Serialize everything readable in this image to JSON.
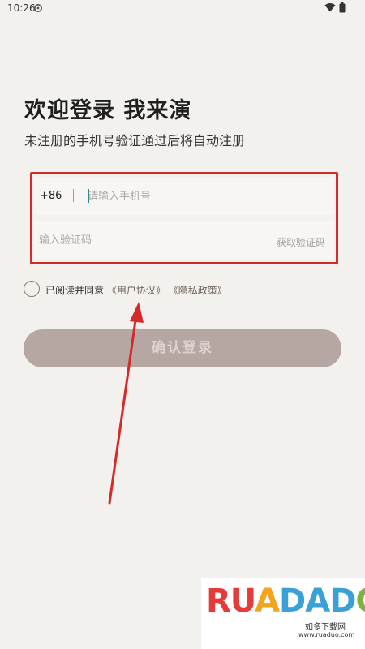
{
  "status_bar": {
    "time": "10:26",
    "icons": [
      "settings-icon",
      "wifi-icon",
      "battery-icon"
    ]
  },
  "header": {
    "title": "欢迎登录 我来演",
    "subtitle": "未注册的手机号验证通过后将自动注册"
  },
  "phone": {
    "country_code": "+86",
    "placeholder": "请输入手机号",
    "value": ""
  },
  "verification": {
    "placeholder": "输入验证码",
    "value": "",
    "get_code_label": "获取验证码"
  },
  "agreement": {
    "checked": false,
    "prefix": "已阅读并同意",
    "user_agreement": "《用户协议》",
    "privacy_policy": "《隐私政策》"
  },
  "login_button": {
    "label": "确认登录"
  },
  "annotation": {
    "box_color": "#d42a2a",
    "arrow_color": "#d42a2a"
  },
  "watermark": {
    "logo_parts": [
      "RU",
      "A",
      "DAD",
      "O"
    ],
    "cn_text": "如多下载网",
    "url": "www.ruaduo.com"
  },
  "colors": {
    "background": "#f3f1ee",
    "button": "#b7a7a2",
    "button_text": "#ddd3cf",
    "link": "#6c5c55",
    "caret": "#37858a"
  }
}
